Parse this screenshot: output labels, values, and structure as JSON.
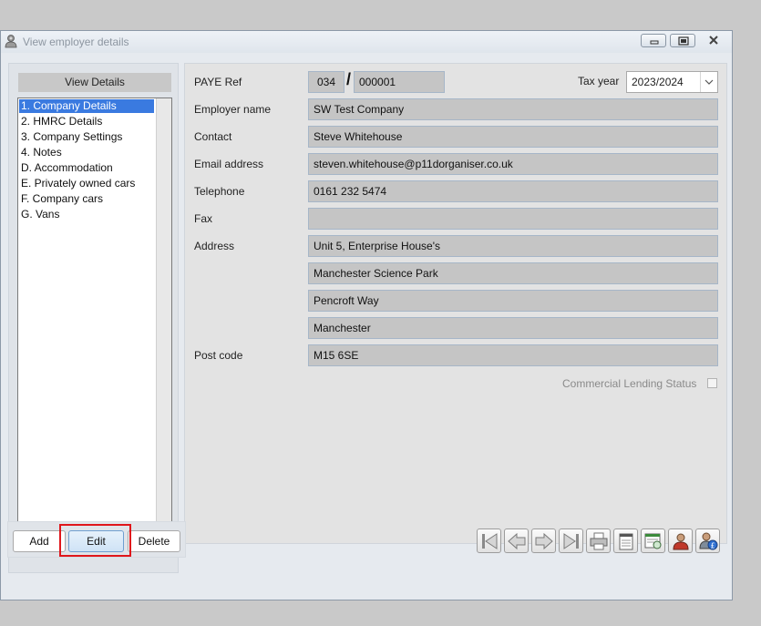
{
  "window": {
    "title": "View employer details",
    "icon": "employer-app-icon",
    "controls": [
      "minimize-icon",
      "restore-icon",
      "close-icon"
    ]
  },
  "sidebar": {
    "header": "View Details",
    "items": [
      {
        "label": "1. Company Details",
        "selected": true
      },
      {
        "label": "2. HMRC Details",
        "selected": false
      },
      {
        "label": "3. Company Settings",
        "selected": false
      },
      {
        "label": "4. Notes",
        "selected": false
      },
      {
        "label": "D. Accommodation",
        "selected": false
      },
      {
        "label": "E. Privately owned cars",
        "selected": false
      },
      {
        "label": "F. Company cars",
        "selected": false
      },
      {
        "label": "G. Vans",
        "selected": false
      }
    ]
  },
  "form": {
    "paye_ref": {
      "label": "PAYE Ref",
      "part1": "034",
      "separator": "/",
      "part2": "000001"
    },
    "tax_year": {
      "label": "Tax year",
      "value": "2023/2024"
    },
    "employer_name": {
      "label": "Employer name",
      "value": "SW Test Company"
    },
    "contact": {
      "label": "Contact",
      "value": "Steve Whitehouse"
    },
    "email": {
      "label": "Email address",
      "value": "steven.whitehouse@p11dorganiser.co.uk"
    },
    "telephone": {
      "label": "Telephone",
      "value": "0161 232 5474"
    },
    "fax": {
      "label": "Fax",
      "value": ""
    },
    "address": {
      "label": "Address",
      "lines": [
        "Unit 5, Enterprise House's",
        "Manchester Science Park",
        "Pencroft Way",
        "Manchester"
      ]
    },
    "postcode": {
      "label": "Post code",
      "value": "M15 6SE"
    },
    "commercial_lending": {
      "label": "Commercial Lending Status",
      "checked": false
    }
  },
  "actions": {
    "add": "Add",
    "edit": "Edit",
    "delete": "Delete"
  },
  "toolbar": {
    "icons": [
      "first-record-icon",
      "previous-record-icon",
      "next-record-icon",
      "last-record-icon",
      "print-icon",
      "notes-icon",
      "report-icon",
      "employees-icon",
      "employee-benefits-icon"
    ]
  },
  "colors": {
    "selection": "#3a7ae0",
    "field_background": "#c5c5c5",
    "highlight": "#e0161b"
  }
}
